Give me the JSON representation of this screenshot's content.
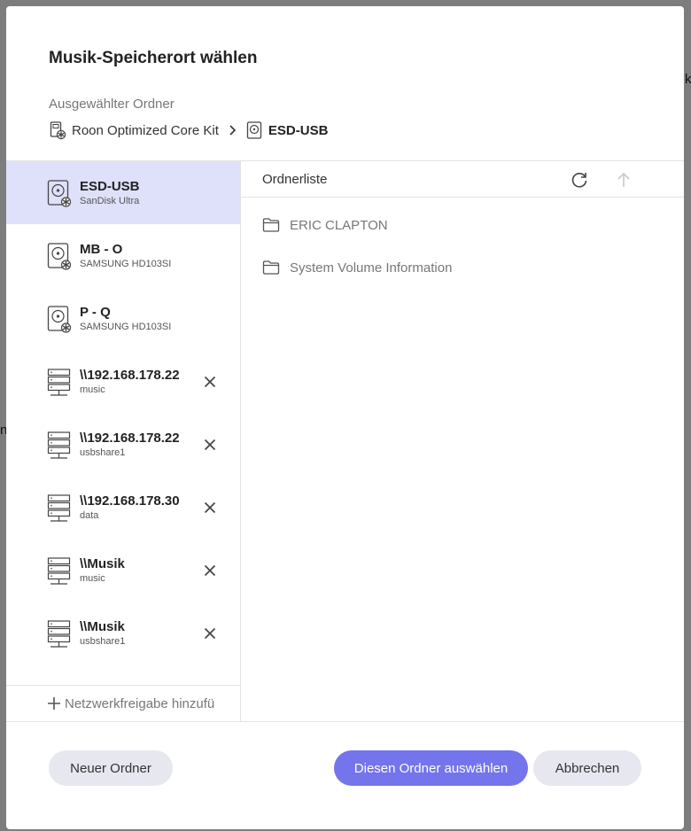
{
  "dialog": {
    "title": "Musik-Speicherort wählen",
    "selected_label": "Ausgewählter Ordner",
    "breadcrumb": {
      "root": "Roon Optimized Core Kit",
      "current": "ESD-USB"
    }
  },
  "sidebar": {
    "devices": [
      {
        "name": "ESD-USB",
        "sub": "SanDisk Ultra",
        "icon": "drive-icon",
        "active": true,
        "removable": false
      },
      {
        "name": "MB - O",
        "sub": "SAMSUNG HD103SI",
        "icon": "drive-icon",
        "active": false,
        "removable": false
      },
      {
        "name": "P - Q",
        "sub": "SAMSUNG HD103SI",
        "icon": "drive-icon",
        "active": false,
        "removable": false
      },
      {
        "name": "\\\\192.168.178.22",
        "sub": "music",
        "icon": "network-share-icon",
        "active": false,
        "removable": true
      },
      {
        "name": "\\\\192.168.178.22",
        "sub": "usbshare1",
        "icon": "network-share-icon",
        "active": false,
        "removable": true
      },
      {
        "name": "\\\\192.168.178.30",
        "sub": "data",
        "icon": "network-share-icon",
        "active": false,
        "removable": true
      },
      {
        "name": "\\\\Musik",
        "sub": "music",
        "icon": "network-share-icon",
        "active": false,
        "removable": true
      },
      {
        "name": "\\\\Musik",
        "sub": "usbshare1",
        "icon": "network-share-icon",
        "active": false,
        "removable": true
      }
    ],
    "add_share_label": "Netzwerkfreigabe hinzufü"
  },
  "folders": {
    "header": "Ordnerliste",
    "items": [
      "ERIC CLAPTON",
      "System Volume Information"
    ]
  },
  "buttons": {
    "new_folder": "Neuer Ordner",
    "select": "Diesen Ordner auswählen",
    "cancel": "Abbrechen"
  },
  "background": {
    "right_fragment": "k",
    "left_fragment": "n"
  },
  "colors": {
    "accent": "#7474ec",
    "active_row": "#dfe0fa",
    "secondary_button": "#e6e7ef"
  }
}
